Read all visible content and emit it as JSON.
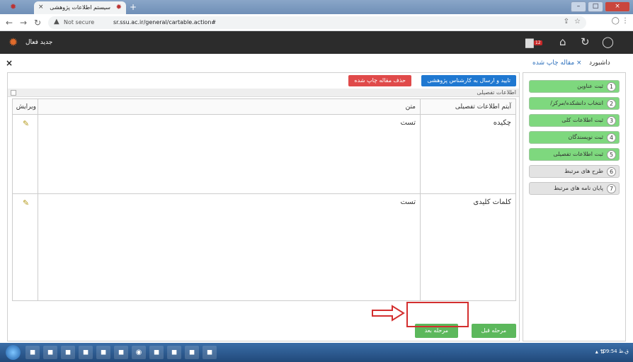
{
  "browser": {
    "tab_title": "سیستم اطلاعات پژوهشی",
    "tab_close": "×",
    "new_tab": "+",
    "not_secure": "Not secure",
    "url": "sr.ssu.ac.ir/general/cartable.action#",
    "win_min": "–",
    "win_max": "□",
    "win_close": "×",
    "tab_dropdown": "⌄"
  },
  "app_header": {
    "active_label": "جدید فعال",
    "notification_count": "12"
  },
  "page_tabs": {
    "close": "×",
    "dashboard": "داشبورد",
    "current_close": "×",
    "current": "مقاله چاپ شده"
  },
  "toolbar": {
    "submit_label": "تایید و ارسال به کارشناس پژوهشی",
    "delete_label": "حذف مقاله چاپ شده"
  },
  "section": {
    "title": "اطلاعات تفصیلی"
  },
  "grid": {
    "headers": {
      "item": "آیتم اطلاعات تفصیلی",
      "text": "متن",
      "edit": "ویرایش"
    },
    "rows": [
      {
        "item": "چکیده",
        "text": "تست"
      },
      {
        "item": "کلمات کلیدی",
        "text": "تست"
      }
    ]
  },
  "nav_buttons": {
    "prev": "مرحله قبل",
    "next": "مرحله بعد"
  },
  "steps": [
    {
      "num": "1",
      "label": "ثبت عناوین",
      "done": true
    },
    {
      "num": "2",
      "label": "انتخاب دانشکده/مرکز/",
      "done": true
    },
    {
      "num": "3",
      "label": "ثبت اطلاعات کلی",
      "done": true
    },
    {
      "num": "4",
      "label": "ثبت نویسندگان",
      "done": true
    },
    {
      "num": "5",
      "label": "ثبت اطلاعات تفصیلی",
      "done": true
    },
    {
      "num": "6",
      "label": "طرح های مرتبط",
      "done": false
    },
    {
      "num": "7",
      "label": "پایان نامه های مرتبط",
      "done": false
    }
  ],
  "taskbar": {
    "clock": "09:54 ق.ظ"
  },
  "colors": {
    "step_done": "#7ed87e",
    "step_pending": "#e3e3e3",
    "submit_btn": "#1f78d1",
    "delete_btn": "#e04a4a",
    "nav_btn": "#5cb85c",
    "highlight": "#d32f2f"
  }
}
